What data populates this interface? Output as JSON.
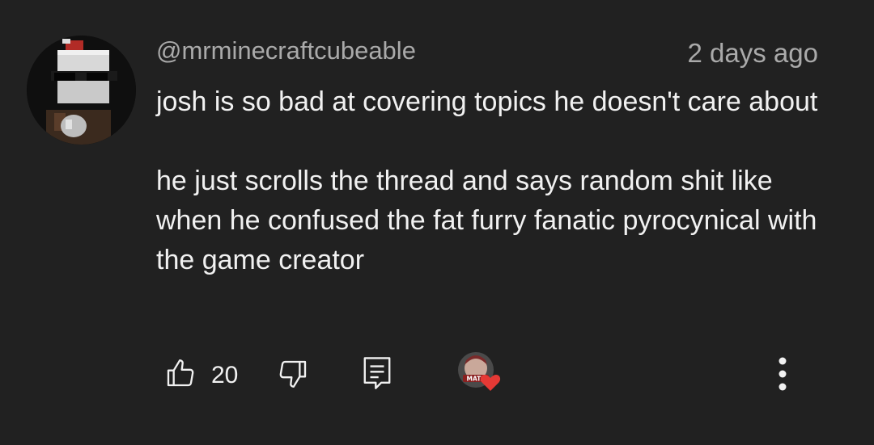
{
  "comment": {
    "author": "@mrminecraftcubeable",
    "timestamp": "2 days ago",
    "paragraphs": [
      "josh is so bad at covering topics he doesn't care about",
      "he just scrolls the thread and says random shit like when he confused the fat furry fanatic pyrocynical with the game creator"
    ],
    "likes": "20"
  },
  "icons": {
    "like": "thumbs-up-icon",
    "dislike": "thumbs-down-icon",
    "reply": "reply-icon",
    "creator_heart": "creator-heart-icon",
    "more": "more-vert-icon"
  },
  "creator_heart": {
    "label": "MATA"
  },
  "colors": {
    "background": "#212121",
    "text": "#f1f1f1",
    "secondary_text": "#aaaaaa",
    "heart": "#e53935"
  }
}
